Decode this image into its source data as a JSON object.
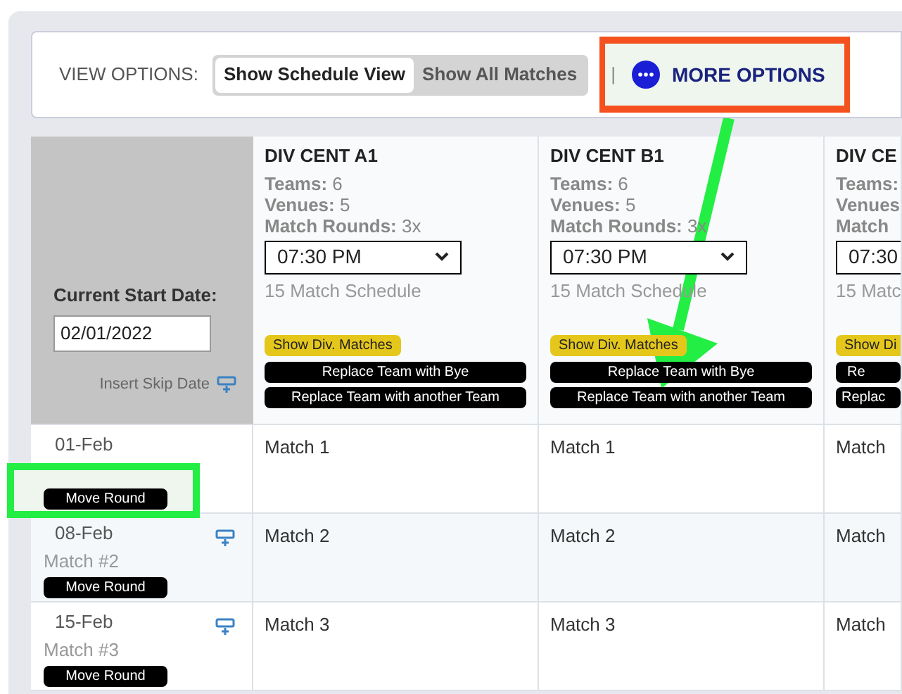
{
  "toolbar": {
    "label": "VIEW OPTIONS:",
    "views": [
      {
        "label": "Show Schedule View",
        "selected": true
      },
      {
        "label": "Show All Matches",
        "selected": false
      }
    ],
    "separator": "|",
    "more_options": {
      "label": "MORE OPTIONS",
      "highlighted": true
    }
  },
  "start": {
    "label": "Current Start Date:",
    "value": "02/01/2022",
    "skip_label": "Insert Skip Date"
  },
  "divisions": [
    {
      "name": "DIV CENT A1",
      "stats": [
        {
          "label": "Teams:",
          "value": "6"
        },
        {
          "label": "Venues:",
          "value": "5"
        },
        {
          "label": "Match Rounds:",
          "value": "3x"
        }
      ],
      "time": "07:30 PM",
      "schedule": "15 Match Schedule",
      "show": "Show Div. Matches",
      "bye": "Replace Team with Bye",
      "replace": "Replace Team with another Team",
      "matches": [
        "Match 1",
        "Match 2",
        "Match 3"
      ]
    },
    {
      "name": "DIV CENT B1",
      "stats": [
        {
          "label": "Teams:",
          "value": "6"
        },
        {
          "label": "Venues:",
          "value": "5"
        },
        {
          "label": "Match Rounds:",
          "value": "3x"
        }
      ],
      "time": "07:30 PM",
      "schedule": "15 Match Schedule",
      "show": "Show Div. Matches",
      "bye": "Replace Team with Bye",
      "replace": "Replace Team with another Team",
      "matches": [
        "Match 1",
        "Match 2",
        "Match 3"
      ]
    },
    {
      "name": "DIV CE",
      "stats": [
        {
          "label": "Teams:"
        },
        {
          "label": "Venues"
        },
        {
          "label": "Match"
        }
      ],
      "time": "07:30",
      "schedule": "15 Matc",
      "show": "Show Di",
      "bye": "Re",
      "replace": "Replac",
      "matches": [
        "Match",
        "Match",
        "Match"
      ]
    }
  ],
  "rounds": [
    {
      "date": "01-Feb",
      "move": "Move Round",
      "insert_skip": false,
      "highlighted": true
    },
    {
      "date": "08-Feb",
      "label": "Match #2",
      "move": "Move Round",
      "insert_skip": true,
      "highlighted": false
    },
    {
      "date": "15-Feb",
      "label": "Match #3",
      "move": "Move Round",
      "insert_skip": true,
      "highlighted": false
    }
  ],
  "arrow": true
}
